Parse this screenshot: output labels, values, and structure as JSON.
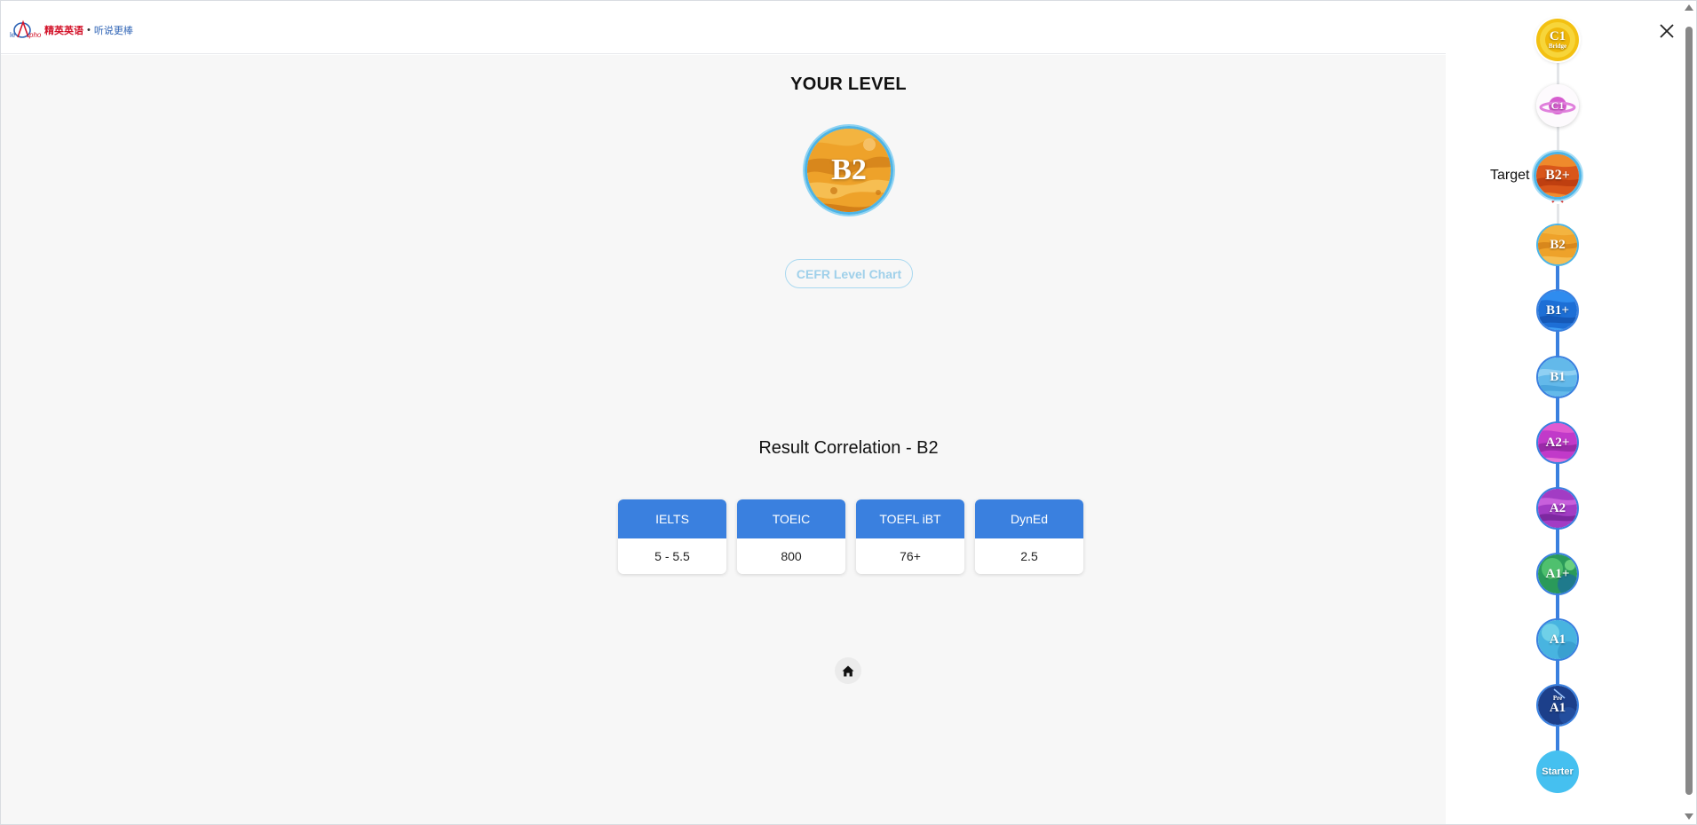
{
  "header": {
    "logo_brand": "精英英语",
    "logo_separator": "•",
    "logo_slogan": "听说更棒"
  },
  "main": {
    "your_level_title": "YOUR LEVEL",
    "current_level": "B2",
    "cefr_button": "CEFR Level Chart",
    "result_title": "Result Correlation - B2",
    "correlations": [
      {
        "name": "IELTS",
        "value": "5 - 5.5"
      },
      {
        "name": "TOEIC",
        "value": "800"
      },
      {
        "name": "TOEFL iBT",
        "value": "76+"
      },
      {
        "name": "DynEd",
        "value": "2.5"
      }
    ],
    "home_icon": "home-icon"
  },
  "ladder": {
    "target_label": "Target",
    "levels": [
      {
        "label": "C1",
        "sub": "Bridge",
        "theme": "yellow"
      },
      {
        "label": "C1",
        "theme": "pink-ring"
      },
      {
        "label": "B2+",
        "theme": "orange-red",
        "is_target": true
      },
      {
        "label": "B2",
        "theme": "orange",
        "is_current": true
      },
      {
        "label": "B1+",
        "theme": "blue"
      },
      {
        "label": "B1",
        "theme": "light-blue"
      },
      {
        "label": "A2+",
        "theme": "magenta"
      },
      {
        "label": "A2",
        "theme": "purple"
      },
      {
        "label": "A1+",
        "theme": "green"
      },
      {
        "label": "A1",
        "theme": "cyan"
      },
      {
        "label": "A1",
        "pre": "Pre",
        "theme": "navy"
      },
      {
        "label": "Starter",
        "theme": "sky"
      }
    ]
  },
  "colors": {
    "accent": "#3a80df",
    "current_ring": "#4db4e6",
    "target_arrow": "#d9302c"
  },
  "window": {
    "close_icon": "close-icon"
  }
}
